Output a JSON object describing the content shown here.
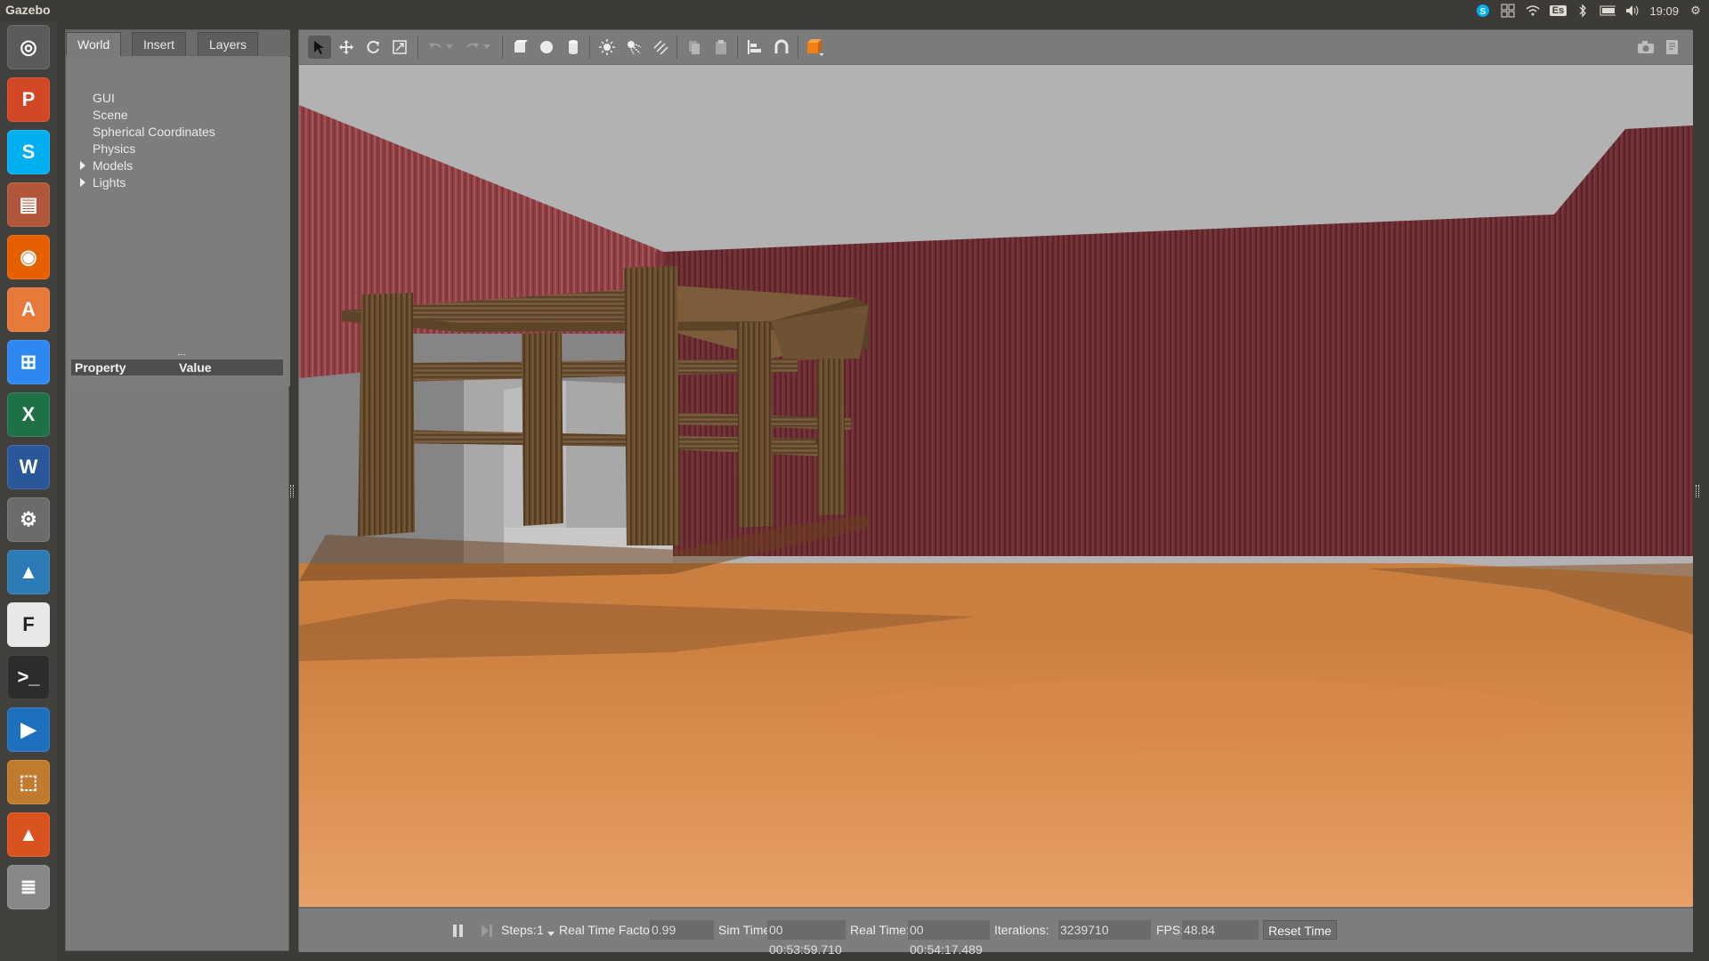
{
  "app_title": "Gazebo",
  "system_tray": {
    "keyboard_layout": "Es",
    "clock": "19:09",
    "icons": [
      "skype-tray-icon",
      "workspace-switcher-icon",
      "wifi-icon",
      "keyboard-layout-icon",
      "bluetooth-icon",
      "battery-icon",
      "volume-icon",
      "clock",
      "settings-gear-icon"
    ]
  },
  "launcher": {
    "items": [
      {
        "name": "ubuntu-dash",
        "glyph": "◎",
        "color": "#5b5b5b"
      },
      {
        "name": "powerpoint",
        "glyph": "P",
        "color": "#d24726"
      },
      {
        "name": "skype",
        "glyph": "S",
        "color": "#00aff0"
      },
      {
        "name": "files",
        "glyph": "▤",
        "color": "#b1563a"
      },
      {
        "name": "firefox",
        "glyph": "◉",
        "color": "#e66000"
      },
      {
        "name": "software-center",
        "glyph": "A",
        "color": "#e7793b"
      },
      {
        "name": "windows-app",
        "glyph": "⊞",
        "color": "#2d89ef"
      },
      {
        "name": "excel",
        "glyph": "X",
        "color": "#1e7145"
      },
      {
        "name": "word",
        "glyph": "W",
        "color": "#2b579a"
      },
      {
        "name": "system-settings",
        "glyph": "⚙",
        "color": "#6b6b6b"
      },
      {
        "name": "matlab",
        "glyph": "▲",
        "color": "#2c7bb6"
      },
      {
        "name": "document-editor",
        "glyph": "F",
        "color": "#e8e8e8"
      },
      {
        "name": "terminal",
        "glyph": ">_",
        "color": "#2c2c2c"
      },
      {
        "name": "media-player",
        "glyph": "▶",
        "color": "#1f6fbf"
      },
      {
        "name": "virtualbox",
        "glyph": "⬚",
        "color": "#c07b2e"
      },
      {
        "name": "matlab-2",
        "glyph": "▲",
        "color": "#d9531e"
      },
      {
        "name": "trash",
        "glyph": "≣",
        "color": "#888888"
      }
    ]
  },
  "left_panel": {
    "tabs": [
      "World",
      "Insert",
      "Layers"
    ],
    "active_tab": "World",
    "tree": [
      "GUI",
      "Scene",
      "Spherical Coordinates",
      "Physics",
      "Models",
      "Lights"
    ],
    "property_header": {
      "property": "Property",
      "value": "Value"
    }
  },
  "toolbar": {
    "buttons": [
      "select-mode-icon",
      "translate-mode-icon",
      "rotate-mode-icon",
      "scale-mode-icon",
      "undo-icon",
      "undo-history-icon",
      "redo-icon",
      "redo-history-icon",
      "box-shape-icon",
      "sphere-shape-icon",
      "cylinder-shape-icon",
      "point-light-icon",
      "spot-light-icon",
      "directional-light-icon",
      "copy-icon",
      "paste-icon",
      "align-icon",
      "snap-icon",
      "view-angle-icon",
      "screenshot-icon",
      "log-icon"
    ]
  },
  "status_bar": {
    "steps_label": "Steps:",
    "steps_value": "1",
    "rtf_label": "Real Time Factor:",
    "rtf_value": "0.99",
    "sim_time_label": "Sim Time:",
    "sim_time_value": "00 00:53:59.710",
    "real_time_label": "Real Time:",
    "real_time_value": "00 00:54:17.489",
    "iterations_label": "Iterations:",
    "iterations_value": "3239710",
    "fps_label": "FPS:",
    "fps_value": "48.84",
    "reset_label": "Reset Time"
  }
}
